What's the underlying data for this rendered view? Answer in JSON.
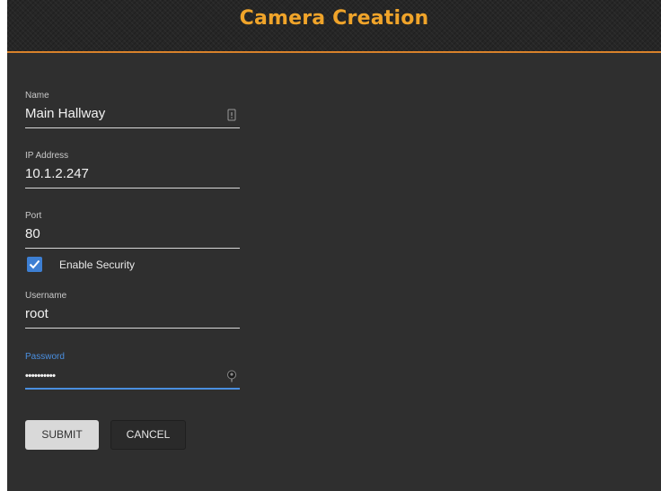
{
  "dialog": {
    "title": "Camera Creation"
  },
  "fields": {
    "name": {
      "label": "Name",
      "value": "Main Hallway",
      "icon": "form-fill-icon"
    },
    "ip_address": {
      "label": "IP Address",
      "value": "10.1.2.247"
    },
    "port": {
      "label": "Port",
      "value": "80"
    },
    "enable_security": {
      "label": "Enable Security",
      "checked": true
    },
    "username": {
      "label": "Username",
      "value": "root"
    },
    "password": {
      "label": "Password",
      "value": "••••••••••",
      "icon": "key-icon"
    }
  },
  "buttons": {
    "submit": "SUBMIT",
    "cancel": "CANCEL"
  },
  "colors": {
    "title": "#f0a42a",
    "accent_line": "#d9822b",
    "focus": "#4a8fe0",
    "background": "#2f2f2f"
  }
}
